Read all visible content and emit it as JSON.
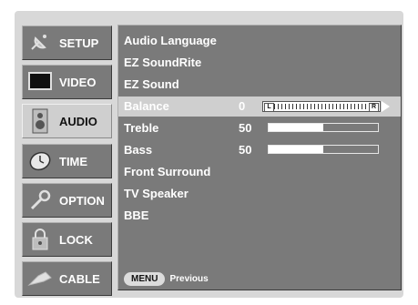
{
  "sidebar": {
    "items": [
      {
        "id": "setup",
        "label": "SETUP",
        "icon": "satellite-icon",
        "active": false
      },
      {
        "id": "video",
        "label": "VIDEO",
        "icon": "tv-screen-icon",
        "active": false
      },
      {
        "id": "audio",
        "label": "AUDIO",
        "icon": "speaker-icon",
        "active": true
      },
      {
        "id": "time",
        "label": "TIME",
        "icon": "clock-icon",
        "active": false
      },
      {
        "id": "option",
        "label": "OPTION",
        "icon": "wrench-icon",
        "active": false
      },
      {
        "id": "lock",
        "label": "LOCK",
        "icon": "padlock-icon",
        "active": false
      },
      {
        "id": "cable",
        "label": "CABLE",
        "icon": "cable-plug-icon",
        "active": false
      }
    ]
  },
  "menu": {
    "items": [
      {
        "label": "Audio Language"
      },
      {
        "label": "EZ SoundRite"
      },
      {
        "label": "EZ Sound"
      },
      {
        "label": "Balance",
        "value": "0",
        "balance": {
          "left_label": "L",
          "right_label": "R"
        },
        "selected": true
      },
      {
        "label": "Treble",
        "value": "50",
        "level_percent": 50
      },
      {
        "label": "Bass",
        "value": "50",
        "level_percent": 50
      },
      {
        "label": "Front Surround"
      },
      {
        "label": "TV Speaker"
      },
      {
        "label": "BBE"
      }
    ]
  },
  "footer": {
    "menu_button": "MENU",
    "hint": "Previous"
  },
  "colors": {
    "panel": "#7a7a7a",
    "highlight": "#cfcfcf",
    "frame": "#d8d8d8",
    "text": "#ffffff"
  }
}
